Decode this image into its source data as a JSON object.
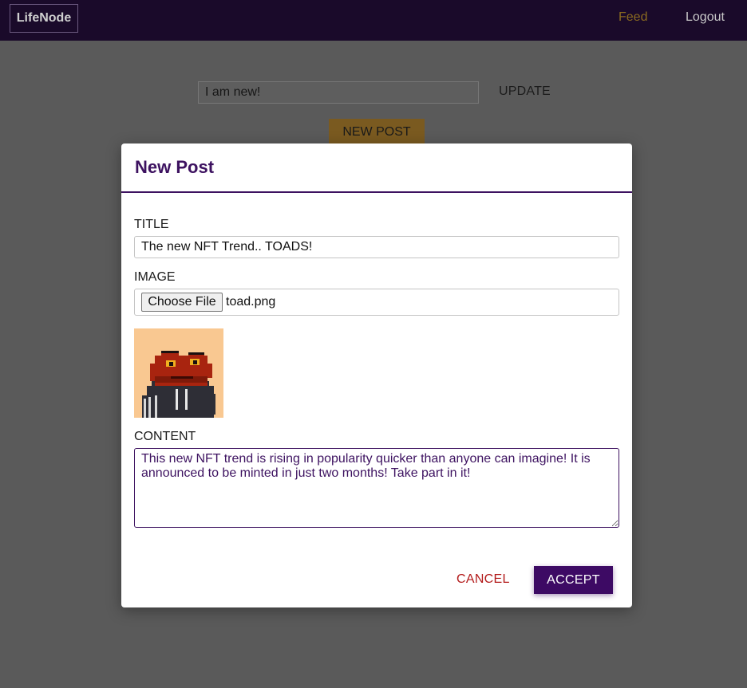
{
  "navbar": {
    "brand": "LifeNode",
    "links": [
      "Feed",
      "Logout"
    ]
  },
  "page": {
    "status_value": "I am new!",
    "update_label": "UPDATE",
    "new_post_label": "NEW POST"
  },
  "modal": {
    "title": "New Post",
    "title_label": "TITLE",
    "title_value": "The new NFT Trend.. TOADS!",
    "image_label": "IMAGE",
    "choose_file_label": "Choose File",
    "file_name": "toad.png",
    "content_label": "CONTENT",
    "content_value": "This new NFT trend is rising in popularity quicker than anyone can imagine! It is announced to be minted in just two months! Take part in it!",
    "cancel_label": "CANCEL",
    "accept_label": "ACCEPT"
  },
  "colors": {
    "navbar_bg": "#1a0a2a",
    "accent_purple": "#3d1260",
    "cancel_red": "#b31b1b",
    "overlay": "#5a5a5a",
    "preview_bg": "#f9c891"
  }
}
